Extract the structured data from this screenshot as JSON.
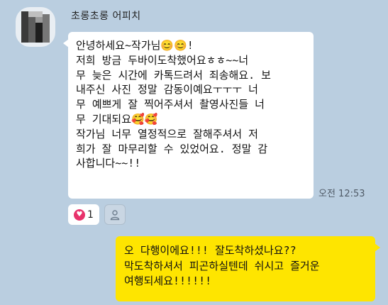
{
  "chat": {
    "sender_name": "초롱초롱 어피치",
    "received_message": "안녕하세요~작가님😊😊!\n저희 방금 두바이도착했어요ㅎㅎ~~너\n무 늦은 시간에 카톡드려서 죄송해요. 보\n내주신 사진 정말 감동이예요ㅜㅜㅜ 너\n무 예쁘게 잘 찍어주셔서 촬영사진들 너\n무 기대되요🥰🥰\n작가님 너무 열정적으로 잘해주셔서 저\n희가 잘 마무리할 수 있었어요. 정말 감\n사합니다~~!!",
    "received_time": "오전 12:53",
    "reaction": {
      "icon": "heart-icon",
      "count": "1",
      "color": "#e8326b"
    },
    "add_reaction_icon": "person-icon",
    "sent_message": "오 다행이에요!!! 잘도착하셨나요??\n막도착하셔서 피곤하실텐데 쉬시고 즐거운\n여행되세요!!!!!!"
  },
  "colors": {
    "background": "#bacee0",
    "received_bubble": "#ffffff",
    "sent_bubble": "#fee500"
  }
}
